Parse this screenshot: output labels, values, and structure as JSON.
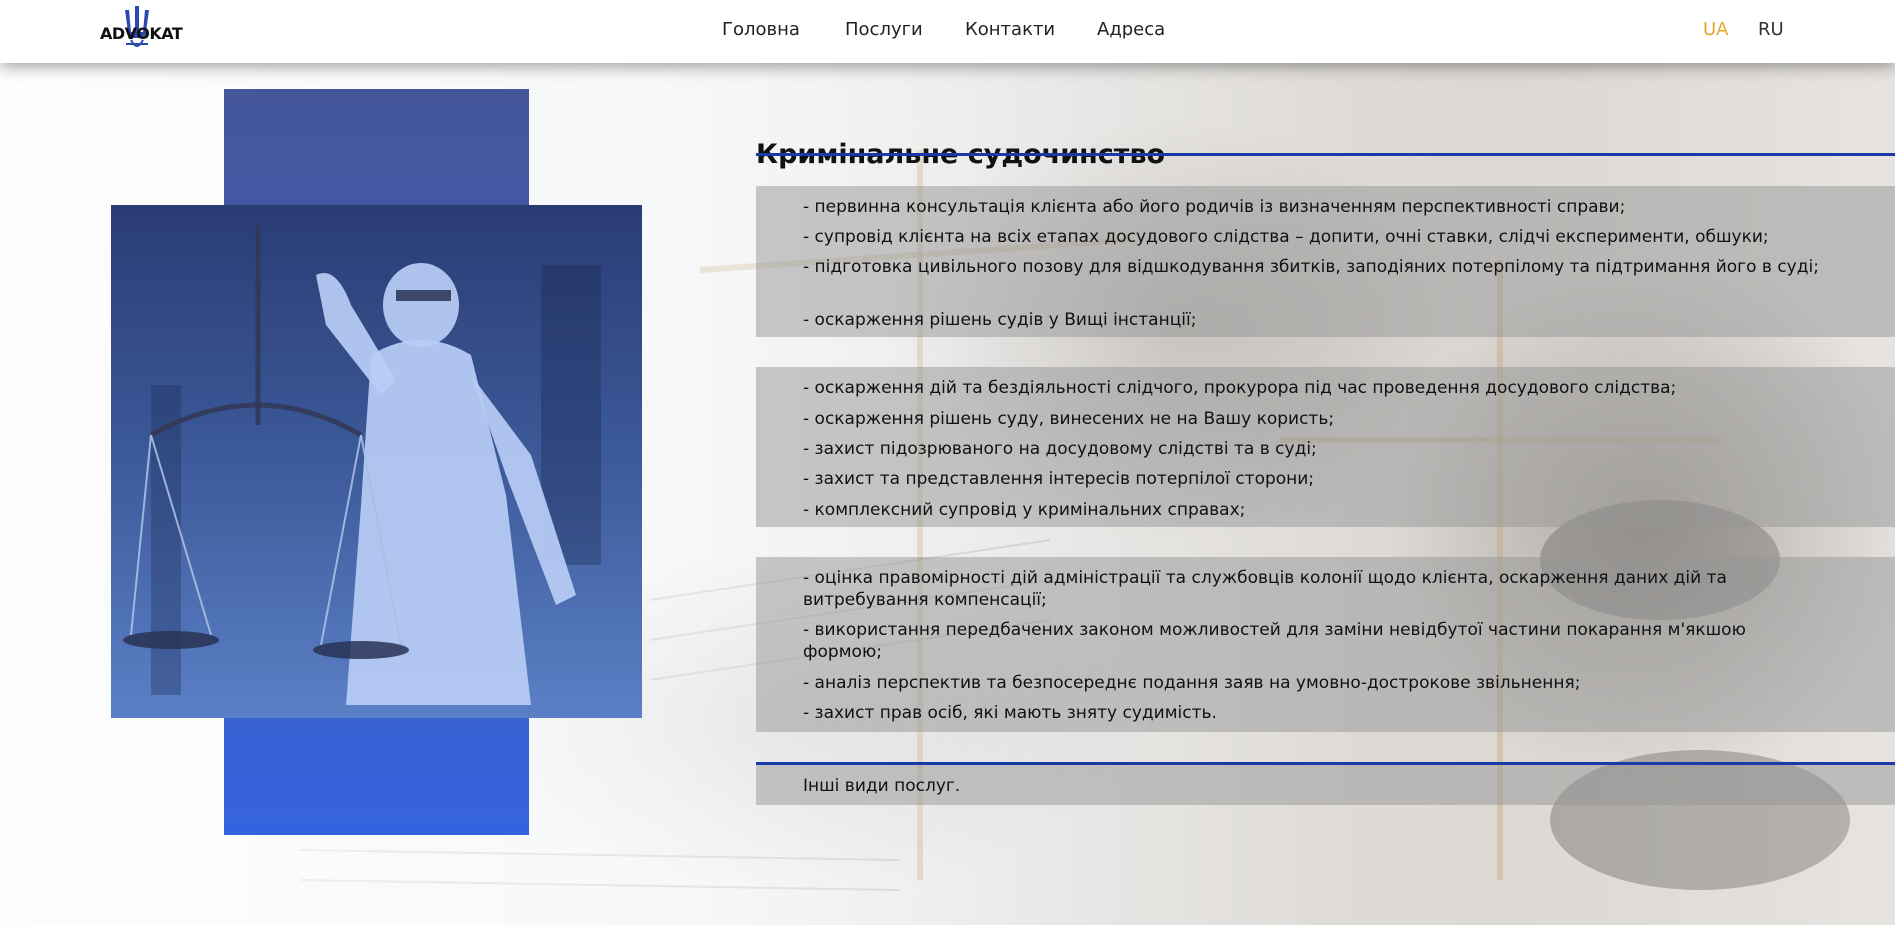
{
  "header": {
    "logo_text": "ADVOKAT",
    "nav": [
      "Головна",
      "Послуги",
      "Контакти",
      "Адреса"
    ],
    "lang_active": "UA",
    "lang_other": "RU"
  },
  "colors": {
    "accent_blue": "#1a3aa8",
    "lang_active": "#e6a52a",
    "panel_blue": "#3d5fba"
  },
  "main": {
    "title": "Кримінальне судочинство",
    "groups": [
      {
        "items": [
          "- первинна консультація клієнта або його родичів із визначенням перспективності справи;",
          "- супровід клієнта на всіх етапах досудового слідства – допити, очні ставки, слідчі експерименти, обшуки;",
          "- підготовка цивільного позову для відшкодування збитків, заподіяних потерпілому та підтримання його в суді;",
          "- оскарження рішень судів у Вищі інстанції;"
        ]
      },
      {
        "items": [
          "- оскарження дій та бездіяльності слідчого, прокурора під час проведення досудового слідства;",
          "- оскарження рішень суду, винесених не на Вашу користь;",
          "- захист підозрюваного на досудовому слідстві та в суді;",
          "- захист та представлення інтересів потерпілої сторони;",
          "- комплексний супровід у кримінальних справах;"
        ]
      },
      {
        "items": [
          "- оцінка правомірності дій адміністрації та службовців колонії щодо клієнта, оскарження даних дій та витребування компенсації;",
          "- використання передбачених законом можливостей для заміни невідбутої частини покарання м'якшою формою;",
          "- аналіз перспектив та безпосереднє подання заяв на умовно-дострокове звільнення;",
          "- захист прав осіб, які мають зняту судимість."
        ]
      }
    ],
    "other_services": "Інші види послуг."
  }
}
